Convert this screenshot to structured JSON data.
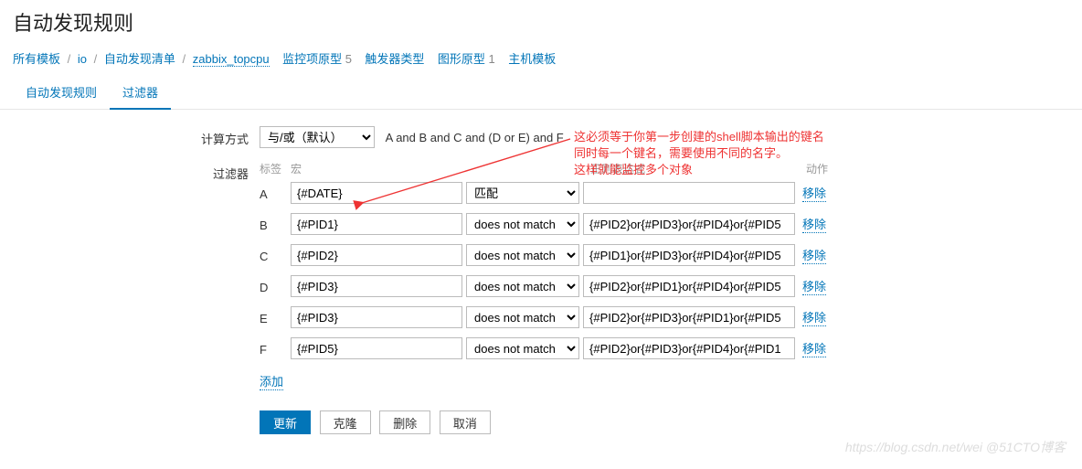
{
  "title": "自动发现规则",
  "breadcrumb": {
    "all_templates": "所有模板",
    "io": "io",
    "discovery_list": "自动发现清单",
    "topcpu": "zabbix_topcpu",
    "item_proto": "监控项原型",
    "item_count": "5",
    "trigger_proto": "触发器类型",
    "graph_proto": "图形原型",
    "graph_count": "1",
    "host_proto": "主机模板"
  },
  "tabs": {
    "discovery": "自动发现规则",
    "filter": "过滤器"
  },
  "form": {
    "calc_label": "计算方式",
    "calc_option": "与/或（默认）",
    "formula": "A and B and C and (D or E) and F",
    "filter_label": "过滤器",
    "head": {
      "h1": "标签",
      "h2": "宏",
      "h3": "正则表达式",
      "h4": "动作"
    },
    "rows": [
      {
        "letter": "A",
        "macro": "{#DATE}",
        "op": "匹配",
        "regexp": ""
      },
      {
        "letter": "B",
        "macro": "{#PID1}",
        "op": "does not match",
        "regexp": "{#PID2}or{#PID3}or{#PID4}or{#PID5"
      },
      {
        "letter": "C",
        "macro": "{#PID2}",
        "op": "does not match",
        "regexp": "{#PID1}or{#PID3}or{#PID4}or{#PID5"
      },
      {
        "letter": "D",
        "macro": "{#PID3}",
        "op": "does not match",
        "regexp": "{#PID2}or{#PID1}or{#PID4}or{#PID5"
      },
      {
        "letter": "E",
        "macro": "{#PID3}",
        "op": "does not match",
        "regexp": "{#PID2}or{#PID3}or{#PID1}or{#PID5"
      },
      {
        "letter": "F",
        "macro": "{#PID5}",
        "op": "does not match",
        "regexp": "{#PID2}or{#PID3}or{#PID4}or{#PID1"
      }
    ],
    "remove": "移除",
    "add": "添加"
  },
  "buttons": {
    "update": "更新",
    "clone": "克隆",
    "delete": "删除",
    "cancel": "取消"
  },
  "annotation": {
    "l1": "这必须等于你第一步创建的shell脚本输出的键名",
    "l2": "同时每一个键名，需要使用不同的名字。",
    "l3": "这样就能监控多个对象"
  },
  "watermark": "https://blog.csdn.net/wei @51CTO博客"
}
